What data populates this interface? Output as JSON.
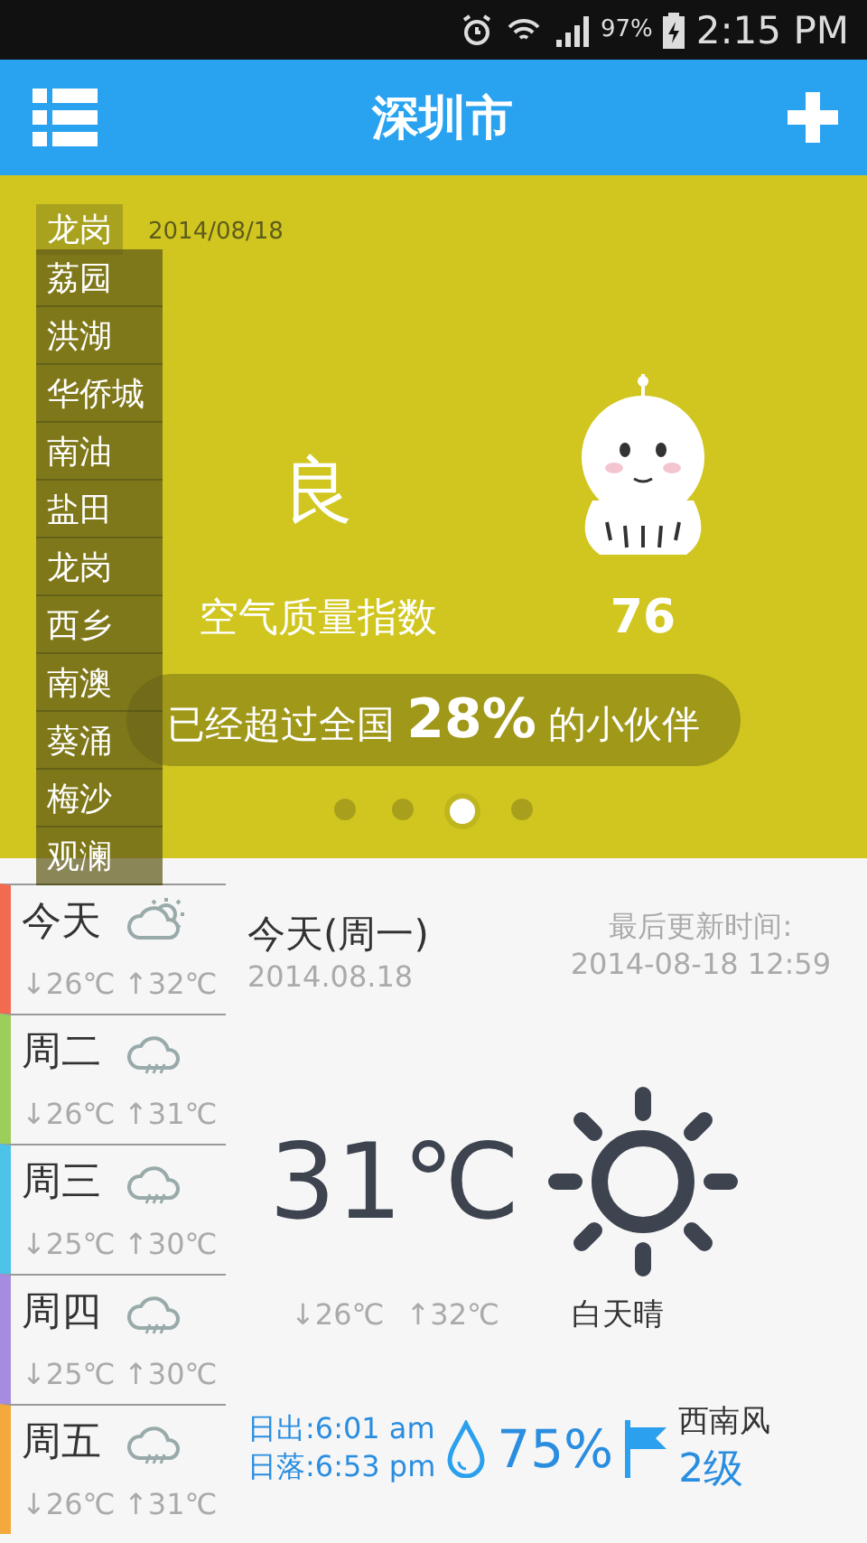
{
  "status_bar": {
    "battery": "97%",
    "time": "2:15 PM"
  },
  "app_bar": {
    "title": "深圳市"
  },
  "air_quality": {
    "district": "龙岗",
    "date": "2014/08/18",
    "rating": "良",
    "index_label": "空气质量指数",
    "index_value": "76",
    "comparison": "已经超过全国 **28%** 的小伙伴",
    "pages": [
      {
        "selected": false
      },
      {
        "selected": false
      },
      {
        "selected": true
      },
      {
        "selected": false
      }
    ]
  },
  "district_menu": {
    "items": [
      {
        "label": "荔园"
      },
      {
        "label": "洪湖"
      },
      {
        "label": "华侨城"
      },
      {
        "label": "南油"
      },
      {
        "label": "盐田"
      },
      {
        "label": "龙岗"
      },
      {
        "label": "西乡"
      },
      {
        "label": "南澳"
      },
      {
        "label": "葵涌"
      },
      {
        "label": "梅沙"
      },
      {
        "label": "观澜"
      }
    ]
  },
  "forecast": [
    {
      "day": "今天",
      "kind": "partly-cloudy",
      "low": "↓26℃",
      "high": "↑32℃",
      "color": "#f26b50"
    },
    {
      "day": "周二",
      "kind": "rain",
      "low": "↓26℃",
      "high": "↑31℃",
      "color": "#9ccf5a"
    },
    {
      "day": "周三",
      "kind": "rain",
      "low": "↓25℃",
      "high": "↑30℃",
      "color": "#4ec3e8"
    },
    {
      "day": "周四",
      "kind": "rain",
      "low": "↓25℃",
      "high": "↑30℃",
      "color": "#a68be0"
    },
    {
      "day": "周五",
      "kind": "rain",
      "low": "↓26℃",
      "high": "↑31℃",
      "color": "#f4a93c"
    }
  ],
  "today": {
    "day": "今天(周一)",
    "date": "2014.08.18",
    "updated_label": "最后更新时间:",
    "updated_time": "2014-08-18 12:59",
    "temperature": "31℃",
    "kind": "sunny",
    "low": "↓26℃",
    "high": "↑32℃",
    "condition": "白天晴",
    "sunrise": "日出:6:01 am",
    "sunset": "日落:6:53 pm",
    "humidity": "75%",
    "wind_direction": "西南风",
    "wind_level": "2级"
  }
}
